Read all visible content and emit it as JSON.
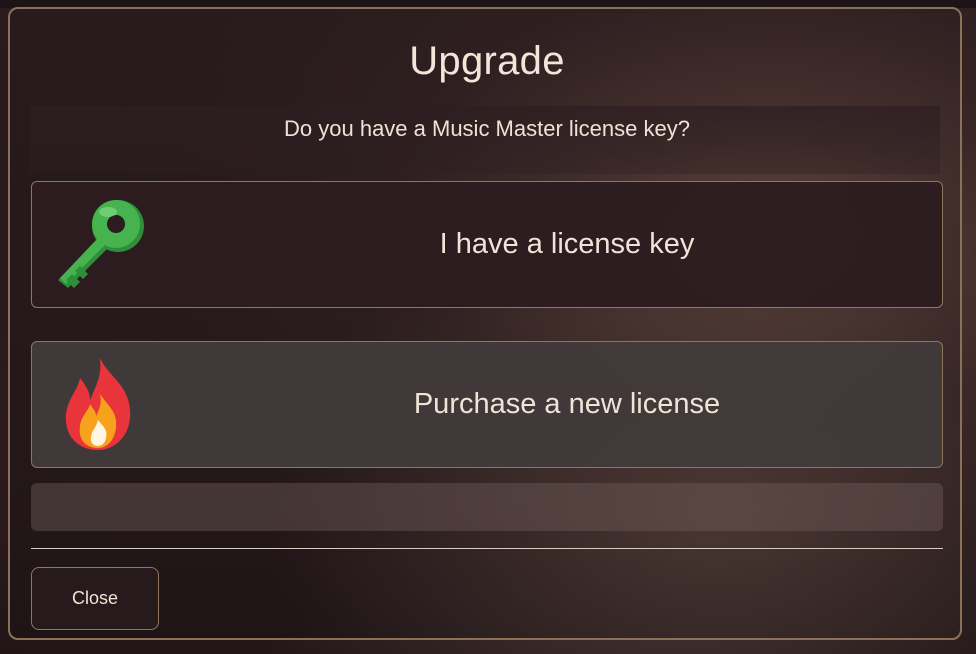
{
  "dialog": {
    "title": "Upgrade",
    "question": "Do you have a Music Master license key?",
    "options": [
      {
        "label": "I have a license key",
        "icon": "key-icon"
      },
      {
        "label": "Purchase a new license",
        "icon": "fire-icon"
      }
    ],
    "close_label": "Close"
  },
  "colors": {
    "border": "#8a7258",
    "text": "#f1e4d6",
    "key_green": "#3aa845",
    "fire_red": "#e8343a",
    "fire_orange": "#f6a21d"
  }
}
